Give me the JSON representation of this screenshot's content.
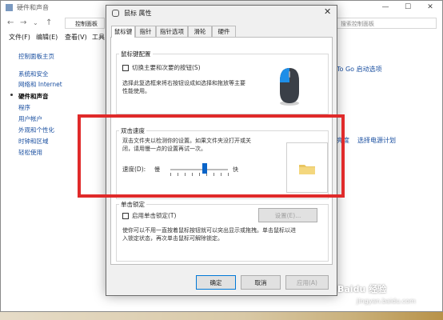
{
  "control_panel": {
    "title": "硬件和声音",
    "window_buttons": [
      "—",
      "☐",
      "✕"
    ],
    "address": "控制面板",
    "search_placeholder": "搜索控制面板",
    "menu": [
      "文件(F)",
      "编辑(E)",
      "查看(V)",
      "工具"
    ],
    "sidebar": [
      "控制面板主页",
      "系统和安全",
      "网络和 Internet",
      "硬件和声音",
      "程序",
      "用户帐户",
      "外观和个性化",
      "时钟和区域",
      "轻松使用"
    ],
    "right_links": [
      "To Go 启动选项",
      "亮度",
      "选择电源计划"
    ]
  },
  "dialog": {
    "title": "鼠标 属性",
    "tabs": [
      "鼠标键",
      "指针",
      "指针选项",
      "滑轮",
      "硬件"
    ],
    "button_config": {
      "legend": "鼠标键配置",
      "checkbox_label": "切换主要和次要的按钮(S)",
      "checked": false,
      "description": "选择此复选框来将右按钮设成如选择和拖放等主要\n性能使用。"
    },
    "double_click": {
      "legend": "双击速度",
      "description": "双击文件夹以检测你的设置。如果文件夹没打开或关\n闭，请用慢一点的设置再试一次。",
      "speed_label": "速度(D):",
      "slow_label": "慢",
      "fast_label": "快",
      "speed_value": 0.6
    },
    "click_lock": {
      "legend": "单击锁定",
      "checkbox_label": "启用单击锁定(T)",
      "checked": false,
      "settings_button": "设置(E)...",
      "description": "使你可以不用一直按着鼠标按钮就可以突出显示或拖拽。单击鼠标以进\n入锁定状态，再次单击鼠标可解除锁定。"
    },
    "buttons": {
      "ok": "确定",
      "cancel": "取消",
      "apply": "应用(A)"
    }
  },
  "watermark": {
    "text": "Baidu 经验",
    "url": "jingyan.baidu.com"
  },
  "colors": {
    "highlight": "#e02a2a",
    "slider": "#0a64c8",
    "link": "#1a4fa0"
  }
}
